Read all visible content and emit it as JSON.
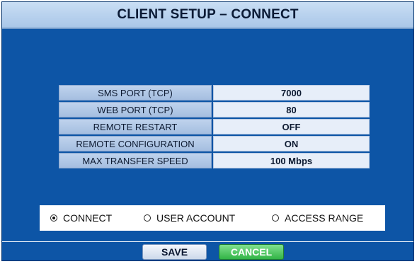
{
  "title": "CLIENT SETUP – CONNECT",
  "settings": [
    {
      "label": "SMS PORT (TCP)",
      "value": "7000"
    },
    {
      "label": "WEB PORT (TCP)",
      "value": "80"
    },
    {
      "label": "REMOTE RESTART",
      "value": "OFF"
    },
    {
      "label": "REMOTE CONFIGURATION",
      "value": "ON"
    },
    {
      "label": "MAX TRANSFER SPEED",
      "value": "100 Mbps"
    }
  ],
  "tabs": [
    {
      "label": "CONNECT",
      "selected": true
    },
    {
      "label": "USER ACCOUNT",
      "selected": false
    },
    {
      "label": "ACCESS RANGE",
      "selected": false
    }
  ],
  "buttons": {
    "save": "SAVE",
    "cancel": "CANCEL"
  },
  "colors": {
    "background": "#0d55a6",
    "title_bar": "#b8d1ef",
    "cancel_button": "#3fbf51"
  }
}
